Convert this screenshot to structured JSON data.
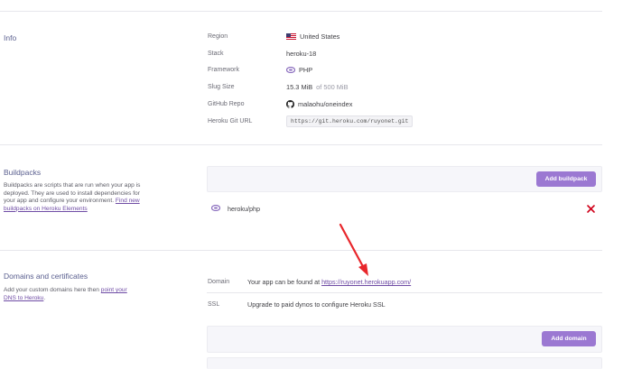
{
  "info": {
    "title": "Info",
    "rows": [
      {
        "label": "Region",
        "value": "United States",
        "icon": "us-flag-icon"
      },
      {
        "label": "Stack",
        "value": "heroku-18"
      },
      {
        "label": "Framework",
        "value": "PHP",
        "icon": "php-icon"
      },
      {
        "label": "Slug Size",
        "value": "15.3 MiB",
        "value_suffix": "of 500 MiB"
      },
      {
        "label": "GitHub Repo",
        "value": "malaohu/oneindex",
        "icon": "github-icon"
      },
      {
        "label": "Heroku Git URL",
        "value": "https://git.heroku.com/ruyonet.git"
      }
    ]
  },
  "buildpacks": {
    "title": "Buildpacks",
    "description": "Buildpacks are scripts that are run when your app is deployed. They are used to install dependencies for your app and configure your environment.",
    "link_text": "Find new buildpacks on Heroku Elements",
    "add_button": "Add buildpack",
    "items": [
      {
        "name": "heroku/php",
        "icon": "php-icon",
        "remove_icon": "close-icon"
      }
    ]
  },
  "domains": {
    "title": "Domains and certificates",
    "description_prefix": "Add your custom domains here then",
    "description_link": "point your DNS to Heroku",
    "description_suffix": ".",
    "rows": [
      {
        "label": "Domain",
        "text": "Your app can be found at",
        "link": "https://ruyonet.herokuapp.com/"
      },
      {
        "label": "SSL",
        "text": "Upgrade to paid dynos to configure Heroku SSL"
      }
    ],
    "add_button": "Add domain"
  },
  "colors": {
    "accent": "#9b78d2",
    "link": "#6f4ca5",
    "remove": "#d0021b",
    "arrow": "#e8262b"
  }
}
